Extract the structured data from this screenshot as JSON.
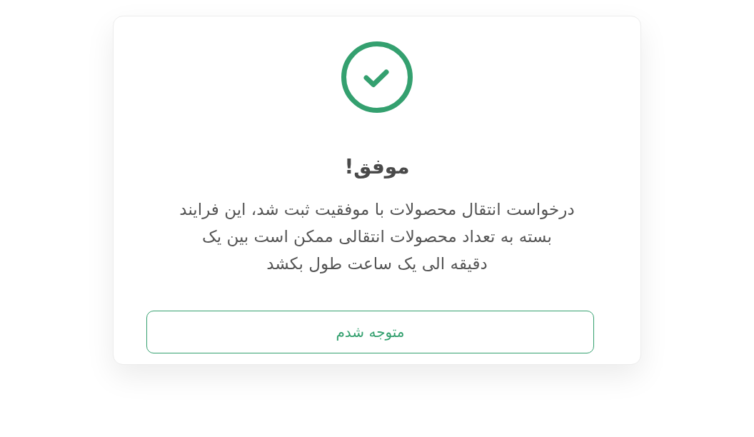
{
  "dialog": {
    "kind": "success",
    "title": "موفق!",
    "message": "درخواست انتقال محصولات با موفقیت ثبت شد، این فرایند\nبسته به تعداد محصولات انتقالی ممکن است بین یک\nدقیقه الی یک ساعت طول بکشد",
    "button": "متوجه شدم"
  }
}
